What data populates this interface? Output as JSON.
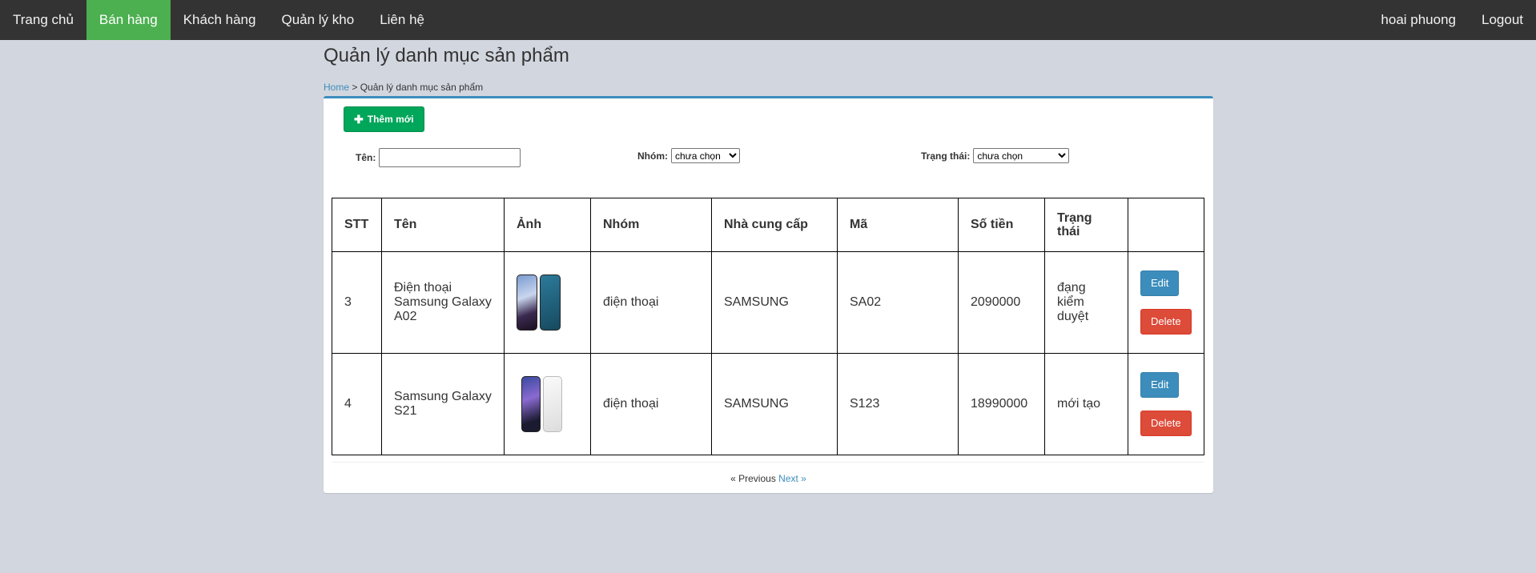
{
  "nav": {
    "left": [
      "Trang chủ",
      "Bán hàng",
      "Khách hàng",
      "Quản lý kho",
      "Liên hệ"
    ],
    "active_index": 1,
    "user": "hoai phuong",
    "logout": "Logout"
  },
  "page": {
    "title": "Quản lý danh mục sản phẩm",
    "breadcrumb_home": "Home",
    "breadcrumb_sep": " > ",
    "breadcrumb_current": "Quản lý danh mục sản phẩm"
  },
  "toolbar": {
    "add_label": "Thêm mới",
    "add_icon": "plus-icon"
  },
  "filters": {
    "name_label": "Tên:",
    "name_value": "",
    "group_label": "Nhóm:",
    "group_selected": "chưa chọn",
    "status_label": "Trạng thái:",
    "status_selected": "chưa chọn"
  },
  "table": {
    "headers": [
      "STT",
      "Tên",
      "Ảnh",
      "Nhóm",
      "Nhà cung cấp",
      "Mã",
      "Số tiền",
      "Trạng thái",
      ""
    ],
    "rows": [
      {
        "stt": "3",
        "name": "Điện thoại Samsung Galaxy A02",
        "group": "điện thoại",
        "supplier": "SAMSUNG",
        "code": "SA02",
        "price": "2090000",
        "status": "đạng kiểm duyệt",
        "edit": "Edit",
        "delete": "Delete",
        "image_colors": [
          "#2a1a3a",
          "#1e5a7a"
        ]
      },
      {
        "stt": "4",
        "name": "Samsung Galaxy S21",
        "group": "điện thoại",
        "supplier": "SAMSUNG",
        "code": "S123",
        "price": "18990000",
        "status": "mới tạo",
        "edit": "Edit",
        "delete": "Delete",
        "image_colors": [
          "#1a2a5a",
          "#eeeeee"
        ]
      }
    ]
  },
  "pager": {
    "prev": "« Previous",
    "next": "Next »"
  },
  "colors": {
    "nav_bg": "#333333",
    "nav_active": "#4caf50",
    "page_bg": "#d2d6de",
    "primary": "#3c8dbc",
    "success": "#00a65a",
    "danger": "#dd4b39"
  }
}
